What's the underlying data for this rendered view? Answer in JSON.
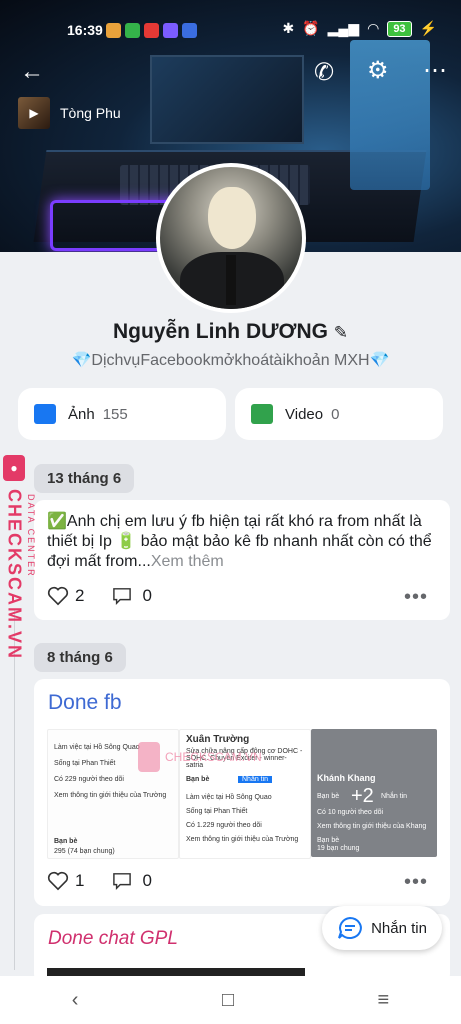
{
  "status": {
    "time": "16:39",
    "battery": "93"
  },
  "music": {
    "artist": "Tòng Phu"
  },
  "profile": {
    "name": "Nguyễn Linh DƯƠNG",
    "bio": "💎DịchvụFacebookmởkhoátàikhoản MXH💎"
  },
  "tiles": [
    {
      "label": "Ảnh",
      "count": "155"
    },
    {
      "label": "Video",
      "count": "0"
    }
  ],
  "posts": [
    {
      "date": "13 tháng 6",
      "text": "✅Anh chị em lưu ý fb hiện tại rất khó ra from nhất là thiết bị Ip 🔋 bảo mật bảo kê fb nhanh nhất còn có thể đợi mất from...",
      "more": "Xem thêm",
      "likes": "2",
      "comments": "0"
    },
    {
      "date": "8 tháng 6",
      "album_title": "Done fb",
      "likes": "1",
      "comments": "0",
      "images": [
        {
          "lines": [
            "Làm việc tại Hồ Sông Quao",
            "Sống tại Phan Thiết",
            "Có 229 người theo dõi",
            "Xem thông tin giới thiệu của Trường",
            "Bạn bè",
            "295 (74 bạn chung)"
          ]
        },
        {
          "name": "Xuân Trường",
          "lines": [
            "Sửa chữa nâng cấp động cơ DOHC - SOHC. Chuyên Exciter - winner- satria",
            "Bạn bè",
            "Nhắn tin",
            "Làm việc tại Hồ Sông Quao",
            "Sống tại Phan Thiết",
            "Có 1.229 người theo dõi",
            "Xem thông tin giới thiệu của Trường"
          ]
        },
        {
          "name": "Khánh Khang",
          "lines": [
            "Bạn bè",
            "Nhắn tin",
            "Có 10 người theo dõi",
            "Xem thông tin giới thiệu của Khang",
            "Bạn bè",
            "19 bạn chung"
          ],
          "more": "+2"
        }
      ]
    },
    {
      "album_title": "Done chat GPL"
    }
  ],
  "fab": {
    "label": "Nhắn tin"
  },
  "watermark": {
    "brand": "CHECKSCAM.VN",
    "sub": "DATA CENTER"
  }
}
